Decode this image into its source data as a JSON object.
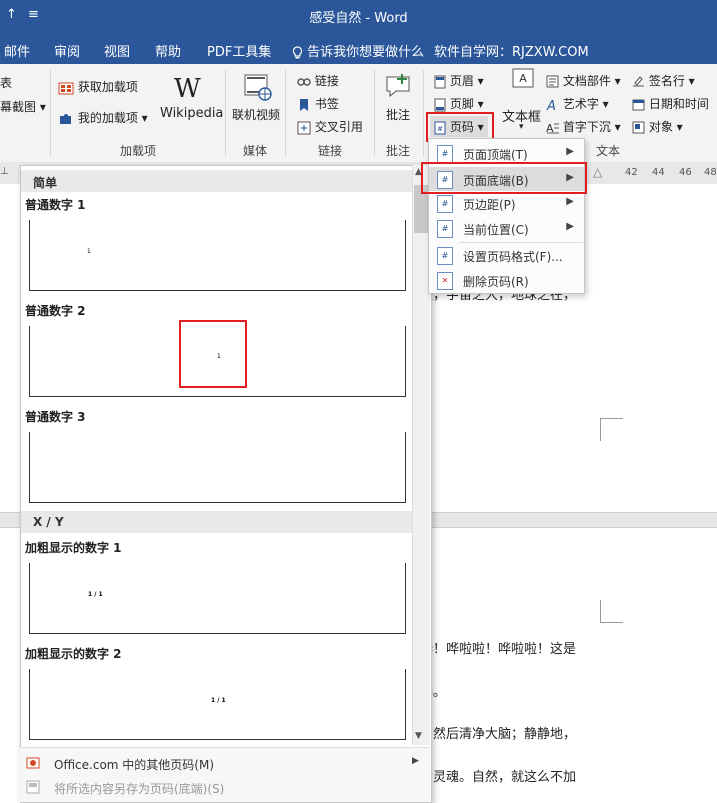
{
  "title_bar": {
    "qat_left": "↑",
    "qat_dropdown": "≡",
    "title": "感受自然  -  Word"
  },
  "tabs": [
    {
      "label": "邮件"
    },
    {
      "label": "审阅"
    },
    {
      "label": "视图"
    },
    {
      "label": "帮助"
    },
    {
      "label": "PDF工具集"
    },
    {
      "label": "告诉我你想要做什么"
    },
    {
      "label": "软件自学网：RJZXW.COM"
    }
  ],
  "ribbon": {
    "partial_left": [
      "表",
      "幕截图 ▾"
    ],
    "addins": {
      "get": "获取加载项",
      "mine": "我的加载项",
      "wikipedia": "Wikipedia",
      "group": "加载项"
    },
    "media": {
      "online_video": "联机视频",
      "group": "媒体"
    },
    "links": {
      "link": "链接",
      "bookmark": "书签",
      "cross_ref": "交叉引用",
      "group": "链接"
    },
    "comments": {
      "comment": "批注",
      "group": "批注"
    },
    "header_footer": {
      "header": "页眉 ▾",
      "footer": "页脚 ▾",
      "page_number": "页码 ▾"
    },
    "text": {
      "textbox": "文本框",
      "doc_parts": "文档部件 ▾",
      "wordart": "艺术字 ▾",
      "dropcap": "首字下沉 ▾",
      "signature": "签名行 ▾",
      "datetime": "日期和时间",
      "object": "对象 ▾",
      "group": "文本"
    }
  },
  "ruler": {
    "numbers": [
      "42",
      "44",
      "46",
      "48",
      "50"
    ]
  },
  "page_number_menu": {
    "items": [
      {
        "label": "页面顶端(T)",
        "has_submenu": true
      },
      {
        "label": "页面底端(B)",
        "has_submenu": true,
        "highlighted": true
      },
      {
        "label": "页边距(P)",
        "has_submenu": true
      },
      {
        "label": "当前位置(C)",
        "has_submenu": true
      },
      {
        "label": "设置页码格式(F)...",
        "has_submenu": false
      },
      {
        "label": "删除页码(R)",
        "has_submenu": false
      }
    ]
  },
  "gallery": {
    "sections": [
      {
        "header": "简单",
        "items": [
          {
            "label": "普通数字 1",
            "sample": "1"
          },
          {
            "label": "普通数字 2",
            "sample": "1"
          },
          {
            "label": "普通数字 3",
            "sample": ""
          }
        ]
      },
      {
        "header": "X / Y",
        "items": [
          {
            "label": "加粗显示的数字 1",
            "sample": "1 / 1"
          },
          {
            "label": "加粗显示的数字 2",
            "sample": "1 / 1"
          }
        ]
      }
    ],
    "footer": {
      "more": "Office.com 中的其他页码(M)",
      "save": "将所选内容另存为页码(底端)(S)"
    }
  },
  "document": {
    "lines": [
      "夫，宇宙之大，地球之在，",
      "哗！哗啦啦！哗啦啦！这是",
      "奏。",
      "，然后清净大脑；静静地，",
      "的灵魂。自然，就这么不加"
    ]
  },
  "colors": {
    "title_bar": "#2b579a",
    "highlight": "#e02020",
    "ribbon": "#f3f3f3"
  }
}
